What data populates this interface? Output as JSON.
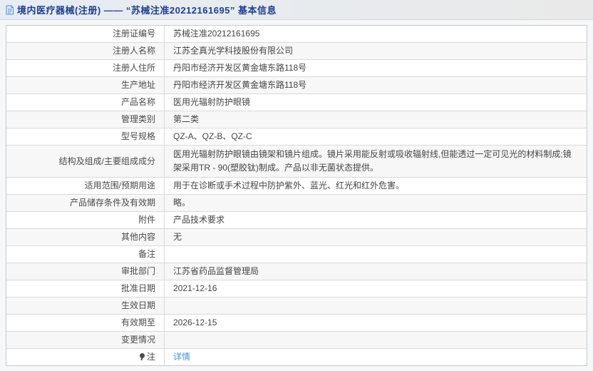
{
  "header": {
    "icon": "document-icon",
    "title": "境内医疗器械(注册) —— “苏械注准20212161695” 基本信息"
  },
  "colors": {
    "title_blue": "#1d3e93",
    "link_blue": "#4394d9",
    "row_alt_bg": "#f7f7f7",
    "border": "#d9d9d9"
  },
  "table": {
    "rows": [
      {
        "label": "注册证编号",
        "value": "苏械注准20212161695"
      },
      {
        "label": "注册人名称",
        "value": "江苏全真光学科技股份有限公司"
      },
      {
        "label": "注册人住所",
        "value": "丹阳市经济开发区黄金塘东路118号"
      },
      {
        "label": "生产地址",
        "value": "丹阳市经济开发区黄金塘东路118号"
      },
      {
        "label": "产品名称",
        "value": "医用光辐射防护眼镜"
      },
      {
        "label": "管理类别",
        "value": "第二类"
      },
      {
        "label": "型号规格",
        "value": "QZ-A、QZ-B、QZ-C"
      },
      {
        "label": "结构及组成/主要组成成分",
        "value": "医用光辐射防护眼镜由镜架和镜片组成。镜片采用能反射或吸收辐射线,但能透过一定可见光的材料制成;镜架采用TR - 90(塑胶钛)制成。产品以非无菌状态提供。"
      },
      {
        "label": "适用范围/预期用途",
        "value": "用于在诊断或手术过程中防护紫外、蓝光、红光和红外危害。"
      },
      {
        "label": "产品储存条件及有效期",
        "value": "略。"
      },
      {
        "label": "附件",
        "value": "产品技术要求"
      },
      {
        "label": "其他内容",
        "value": "无"
      },
      {
        "label": "备注",
        "value": ""
      },
      {
        "label": "审批部门",
        "value": "江苏省药品监督管理局"
      },
      {
        "label": "批准日期",
        "value": "2021-12-16"
      },
      {
        "label": "生效日期",
        "value": ""
      },
      {
        "label": "有效期至",
        "value": "2026-12-15"
      },
      {
        "label": "变更情况",
        "value": ""
      },
      {
        "label": "注",
        "icon": "note-icon",
        "link": "详情"
      }
    ]
  }
}
